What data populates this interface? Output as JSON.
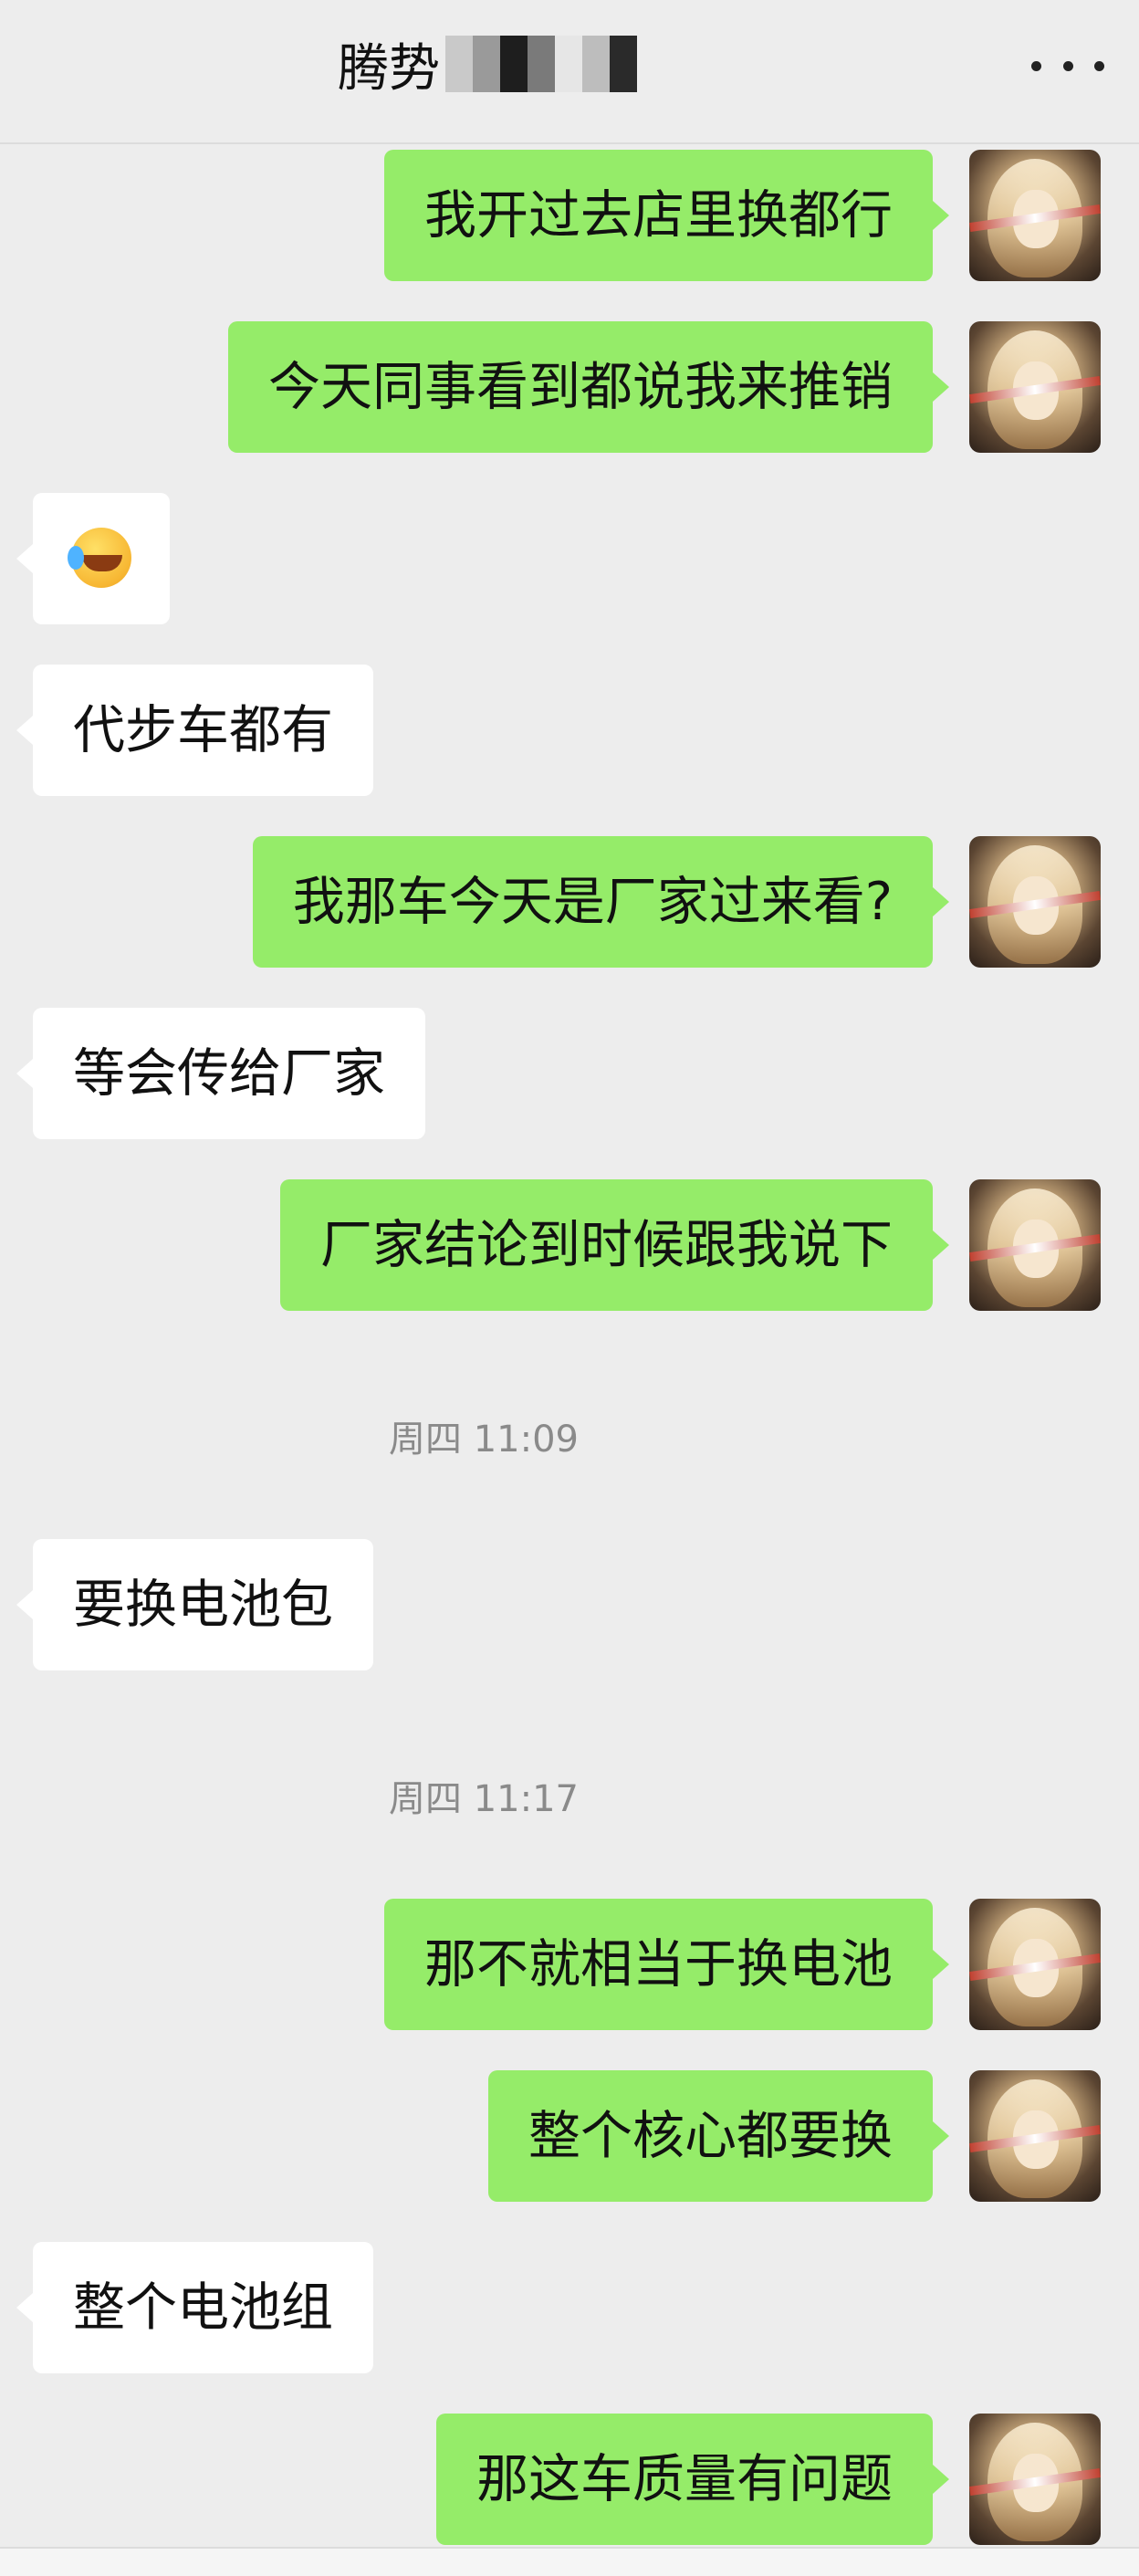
{
  "header": {
    "title": "腾势",
    "more_icon": "more-dots-icon"
  },
  "messages": [
    {
      "side": "out",
      "text": "我开过去店里换都行"
    },
    {
      "side": "out",
      "text": "今天同事看到都说我来推销"
    },
    {
      "side": "in",
      "emoji": "laughing-crying-emoji"
    },
    {
      "side": "in",
      "text": "代步车都有"
    },
    {
      "side": "out",
      "text": "我那车今天是厂家过来看?"
    },
    {
      "side": "in",
      "text": "等会传给厂家"
    },
    {
      "side": "out",
      "text": "厂家结论到时候跟我说下"
    },
    {
      "side": "in",
      "text": "要换电池包"
    },
    {
      "side": "out",
      "text": "那不就相当于换电池"
    },
    {
      "side": "out",
      "text": "整个核心都要换"
    },
    {
      "side": "in",
      "text": "整个电池组"
    },
    {
      "side": "out",
      "text": "那这车质量有问题"
    }
  ],
  "timestamps": [
    {
      "text": "周四 11:09"
    },
    {
      "text": "周四 11:17"
    }
  ],
  "colors": {
    "background": "#ededed",
    "outgoing_bubble": "#95ec69",
    "incoming_bubble": "#ffffff"
  }
}
